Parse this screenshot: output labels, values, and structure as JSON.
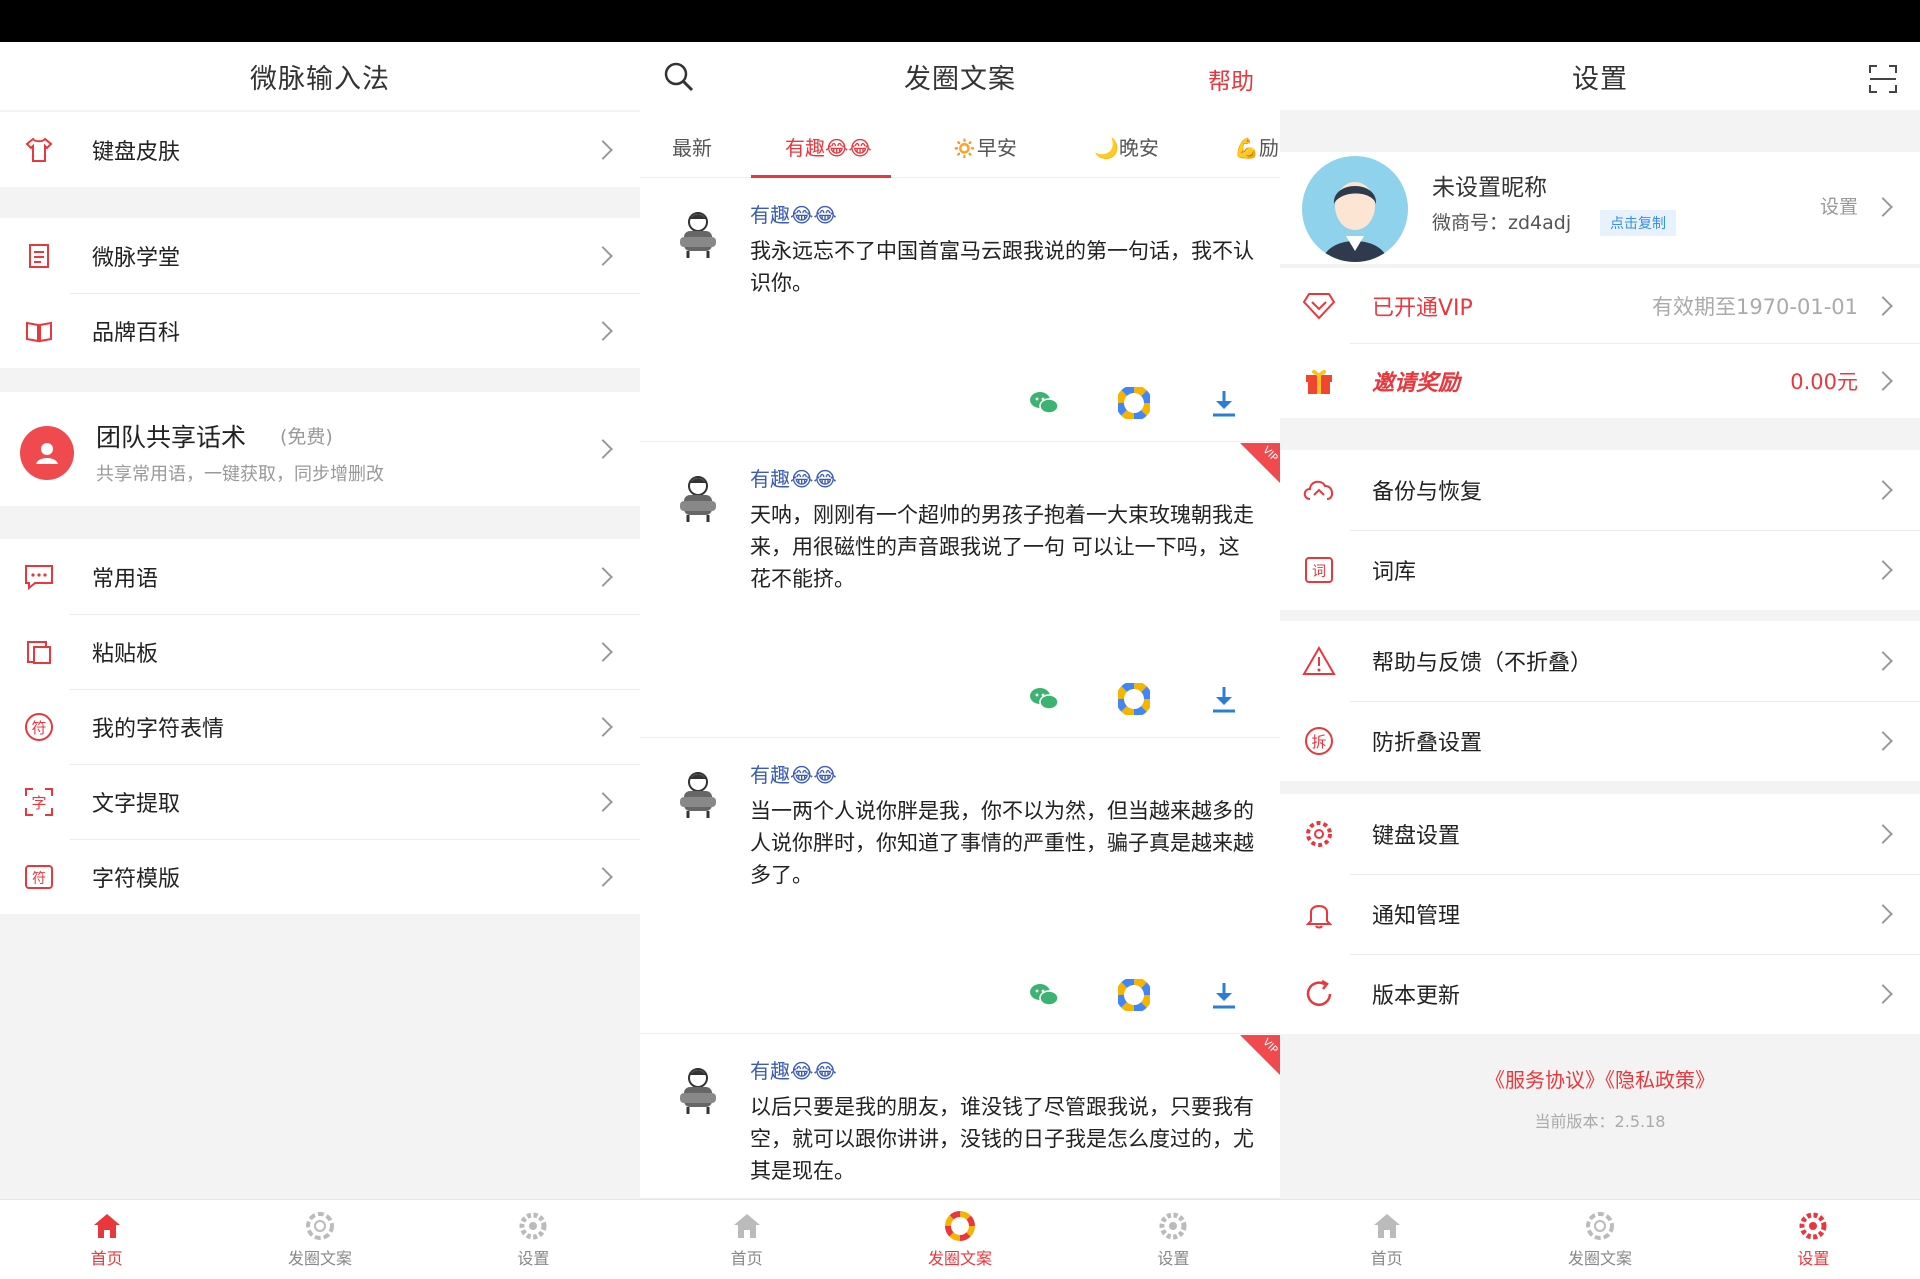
{
  "colors": {
    "accent": "#e8383d",
    "link": "#3b5bb6",
    "bg": "#f3f3f3"
  },
  "nav": {
    "home": "首页",
    "posts": "发圈文案",
    "settings": "设置"
  },
  "panel1": {
    "title": "微脉输入法",
    "items": [
      {
        "label": "键盘皮肤",
        "icon": "tshirt-icon"
      },
      {
        "label": "微脉学堂",
        "icon": "notebook-icon"
      },
      {
        "label": "品牌百科",
        "icon": "book-icon"
      },
      {
        "label": "常用语",
        "icon": "message-icon"
      },
      {
        "label": "粘贴板",
        "icon": "clipboard-icon"
      },
      {
        "label": "我的字符表情",
        "icon": "symbol-icon"
      },
      {
        "label": "文字提取",
        "icon": "scan-text-icon"
      },
      {
        "label": "字符模版",
        "icon": "template-icon"
      }
    ],
    "team": {
      "title": "团队共享话术",
      "badge": "(免费)",
      "subtitle": "共享常用语，一键获取，同步增删改"
    }
  },
  "panel2": {
    "title": "发圈文案",
    "help": "帮助",
    "tabs": [
      "最新",
      "有趣😂😂",
      "🔅早安",
      "🌙晚安",
      "💪励"
    ],
    "posts": [
      {
        "tag": "有趣😂😂",
        "text": "我永远忘不了中国首富马云跟我说的第一句话，我不认识你。",
        "vip": false
      },
      {
        "tag": "有趣😂😂",
        "text": "天呐，刚刚有一个超帅的男孩子抱着一大束玫瑰朝我走来，用很磁性的声音跟我说了一句 可以让一下吗，这花不能挤。",
        "vip": true
      },
      {
        "tag": "有趣😂😂",
        "text": "当一两个人说你胖是我，你不以为然，但当越来越多的人说你胖时，你知道了事情的严重性，骗子真是越来越多了。",
        "vip": false
      },
      {
        "tag": "有趣😂😂",
        "text": "以后只要是我的朋友，谁没钱了尽管跟我说，只要我有空，就可以跟你讲讲，没钱的日子我是怎么度过的，尤其是现在。",
        "vip": true
      }
    ],
    "vip_label": "VIP"
  },
  "panel3": {
    "title": "设置",
    "nickname": "未设置昵称",
    "wechat_id": "微商号：zd4adj",
    "copy": "点击复制",
    "setting": "设置",
    "vip": {
      "label": "已开通VIP",
      "value": "有效期至1970-01-01"
    },
    "invite": {
      "label": "邀请奖励",
      "value": "0.00元"
    },
    "group1": [
      "备份与恢复",
      "词库"
    ],
    "group2": [
      "帮助与反馈（不折叠）",
      "防折叠设置"
    ],
    "group3": [
      "键盘设置",
      "通知管理",
      "版本更新"
    ],
    "links": "《服务协议》《隐私政策》",
    "version": "当前版本：2.5.18"
  }
}
